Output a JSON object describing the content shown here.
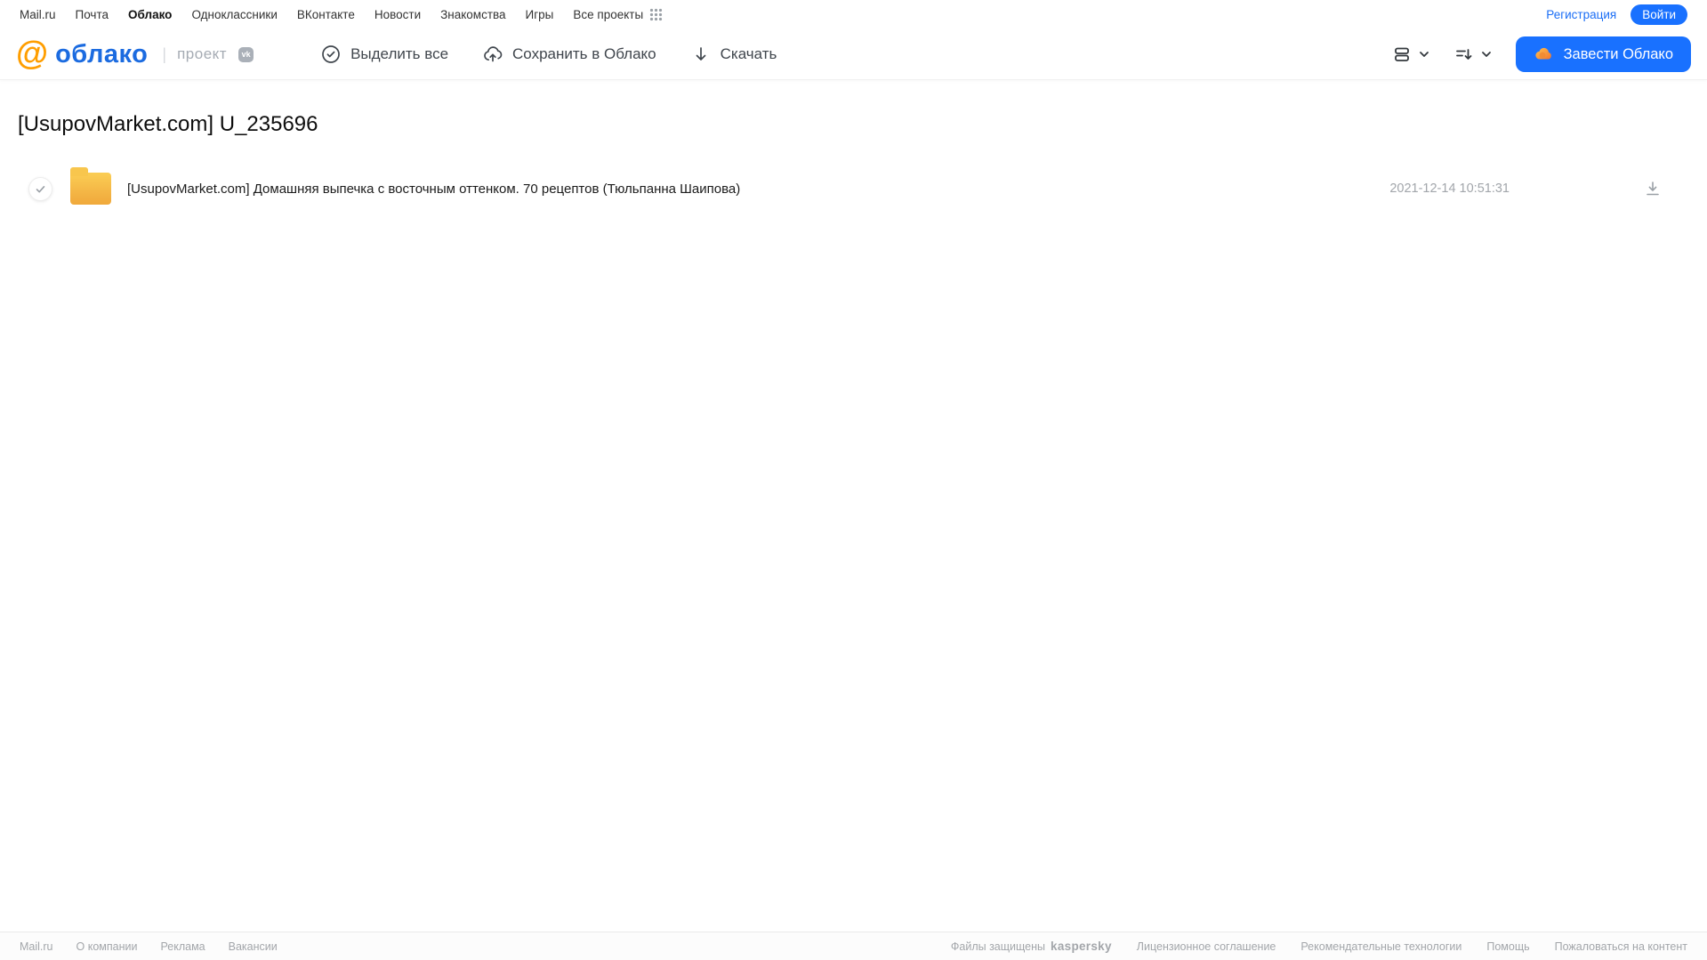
{
  "topnav": {
    "items": [
      "Mail.ru",
      "Почта",
      "Облако",
      "Одноклассники",
      "ВКонтакте",
      "Новости",
      "Знакомства",
      "Игры",
      "Все проекты"
    ],
    "registration_label": "Регистрация",
    "login_label": "Войти"
  },
  "header": {
    "logo_text": "облако",
    "logo_project": "проект",
    "vk_badge": "vk",
    "select_all_label": "Выделить все",
    "save_to_cloud_label": "Сохранить в Облако",
    "download_label": "Скачать",
    "get_cloud_label": "Завести Облако"
  },
  "main": {
    "title": "[UsupovMarket.com] U_235696",
    "rows": [
      {
        "name": "[UsupovMarket.com] Домашняя выпечка с восточным оттенком. 70 рецептов (Тюльпанна Шаипова)",
        "date": "2021-12-14 10:51:31"
      }
    ]
  },
  "footer": {
    "left_links": [
      "Mail.ru",
      "О компании",
      "Реклама",
      "Вакансии"
    ],
    "files_protected_label": "Файлы защищены",
    "kaspersky_label": "kaspersky",
    "right_links": [
      "Лицензионное соглашение",
      "Рекомендательные технологии",
      "Помощь",
      "Пожаловаться на контент"
    ]
  },
  "colors": {
    "accent_blue": "#1971ff",
    "logo_blue": "#1b6be0",
    "logo_orange": "#ff9e00",
    "folder_yellow": "#f5bb45",
    "kaspersky_teal": "#23a38a"
  }
}
